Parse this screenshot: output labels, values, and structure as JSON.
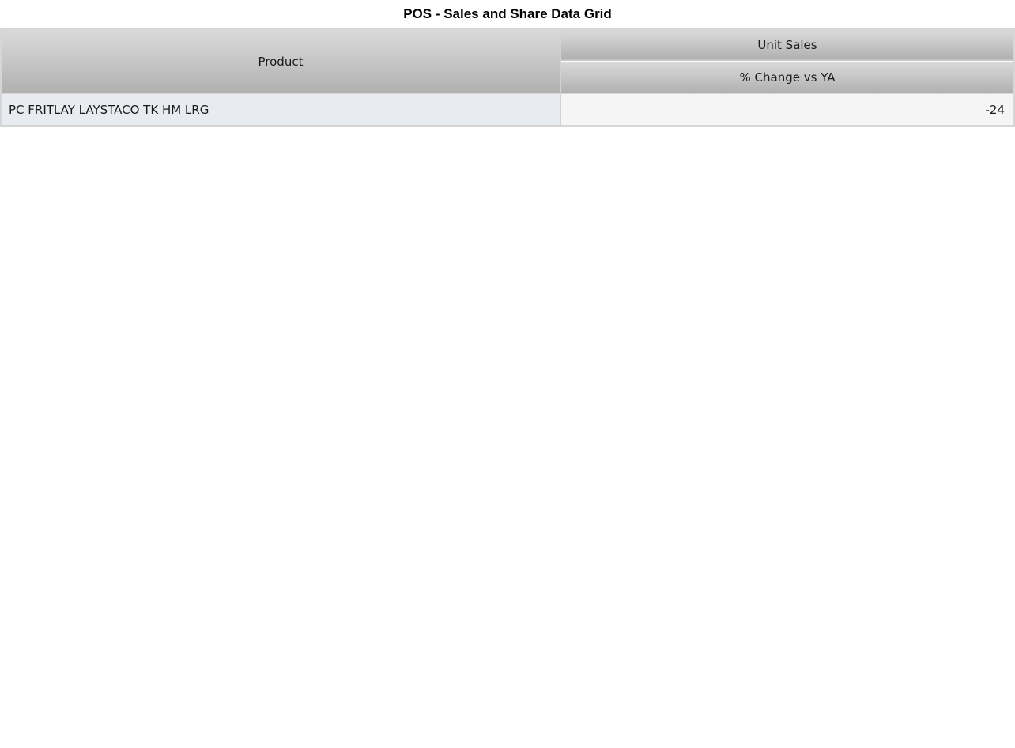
{
  "title": "POS - Sales and Share Data Grid",
  "chart_data": {
    "type": "table",
    "columns": [
      {
        "header": "Product"
      },
      {
        "group": "Unit Sales",
        "header": "% Change vs YA"
      }
    ],
    "rows": [
      {
        "product": "PC FRITLAY LAYSTACO TK HM LRG",
        "pct_change_vs_ya": "-24"
      }
    ]
  },
  "colors": {
    "header_light": "#dadada",
    "header_dark": "#b0b0b0",
    "row_label_bg": "#e8ebf0",
    "row_value_bg": "#f5f5f5",
    "border": "#d6d6d6"
  }
}
